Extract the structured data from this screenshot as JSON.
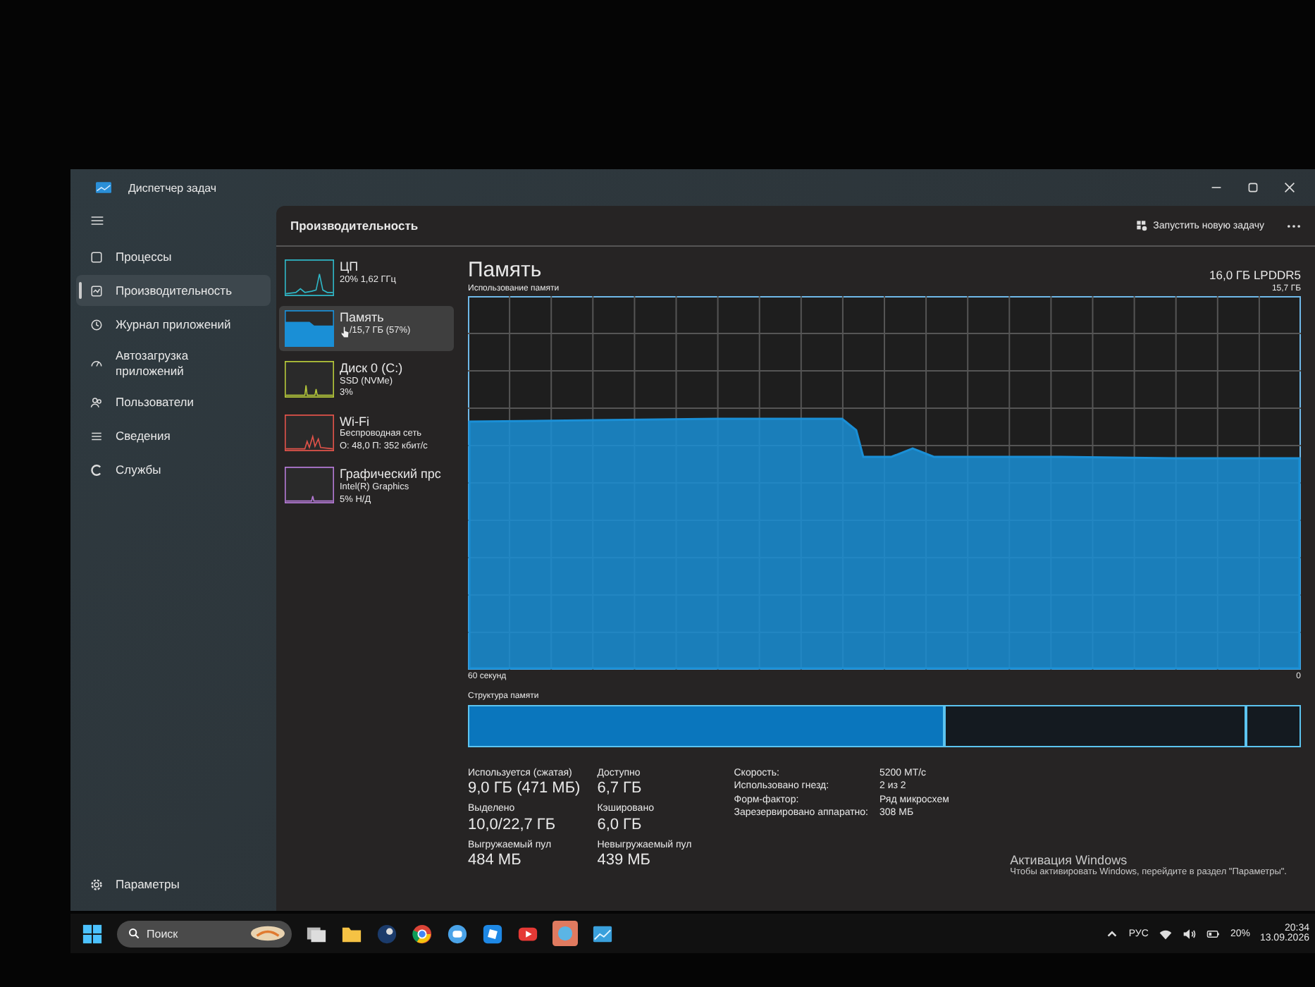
{
  "window": {
    "title": "Диспетчер задач"
  },
  "nav": {
    "items": [
      {
        "kind": "processes",
        "label": "Процессы",
        "selected": false
      },
      {
        "kind": "performance",
        "label": "Производительность",
        "selected": true
      },
      {
        "kind": "history",
        "label": "Журнал приложений",
        "selected": false
      },
      {
        "kind": "startup",
        "label": "Автозагрузка приложений",
        "selected": false
      },
      {
        "kind": "users",
        "label": "Пользователи",
        "selected": false
      },
      {
        "kind": "details",
        "label": "Сведения",
        "selected": false
      },
      {
        "kind": "services",
        "label": "Службы",
        "selected": false
      }
    ],
    "settings": "Параметры"
  },
  "header": {
    "title": "Производительность",
    "run_task": "Запустить новую задачу"
  },
  "devices": [
    {
      "kind": "cpu",
      "name": "ЦП",
      "lines": [
        "20% 1,62 ГГц"
      ],
      "color": "#2fb8c8",
      "selected": false
    },
    {
      "kind": "memory",
      "name": "Память",
      "lines": [
        "/15,7 ГБ (57%)"
      ],
      "color": "#1a8fd6",
      "selected": true
    },
    {
      "kind": "disk",
      "name": "Диск 0 (C:)",
      "lines": [
        "SSD (NVMe)",
        "3%"
      ],
      "color": "#b6c93a",
      "selected": false
    },
    {
      "kind": "wifi",
      "name": "Wi-Fi",
      "lines": [
        "Беспроводная сеть",
        "О: 48,0 П: 352 кбит/с"
      ],
      "color": "#e2534a",
      "selected": false
    },
    {
      "kind": "gpu",
      "name": "Графический прс",
      "lines": [
        "Intel(R) Graphics",
        "5% Н/Д"
      ],
      "color": "#b57ad6",
      "selected": false
    }
  ],
  "detail": {
    "title": "Память",
    "subtitle": "16,0 ГБ LPDDR5",
    "graph": {
      "label": "Использование памяти",
      "max_label": "15,7 ГБ",
      "time_label": "60 секунд",
      "min_label": "0"
    },
    "composition_label": "Структура памяти",
    "stats": [
      {
        "label": "Используется (сжатая)",
        "value": "9,0 ГБ (471 МБ)"
      },
      {
        "label": "Доступно",
        "value": "6,7 ГБ"
      },
      {
        "label": "Выделено",
        "value": "10,0/22,7 ГБ"
      },
      {
        "label": "Кэшировано",
        "value": "6,0 ГБ"
      },
      {
        "label": "Выгружаемый пул",
        "value": "484 МБ"
      },
      {
        "label": "Невыгружаемый пул",
        "value": "439 МБ"
      }
    ],
    "specs": [
      {
        "label": "Скорость:",
        "value": "5200 МТ/с"
      },
      {
        "label": "Использовано гнезд:",
        "value": "2 из 2"
      },
      {
        "label": "Форм-фактор:",
        "value": "Ряд микросхем"
      },
      {
        "label": "Зарезервировано аппаратно:",
        "value": "308 МБ"
      }
    ]
  },
  "activation": {
    "title": "Активация Windows",
    "text": "Чтобы активировать Windows, перейдите в раздел \"Параметры\"."
  },
  "taskbar": {
    "search": "Поиск",
    "language": "РУС",
    "battery": "20%",
    "time": "20:34",
    "date": "13.09.2026"
  }
}
